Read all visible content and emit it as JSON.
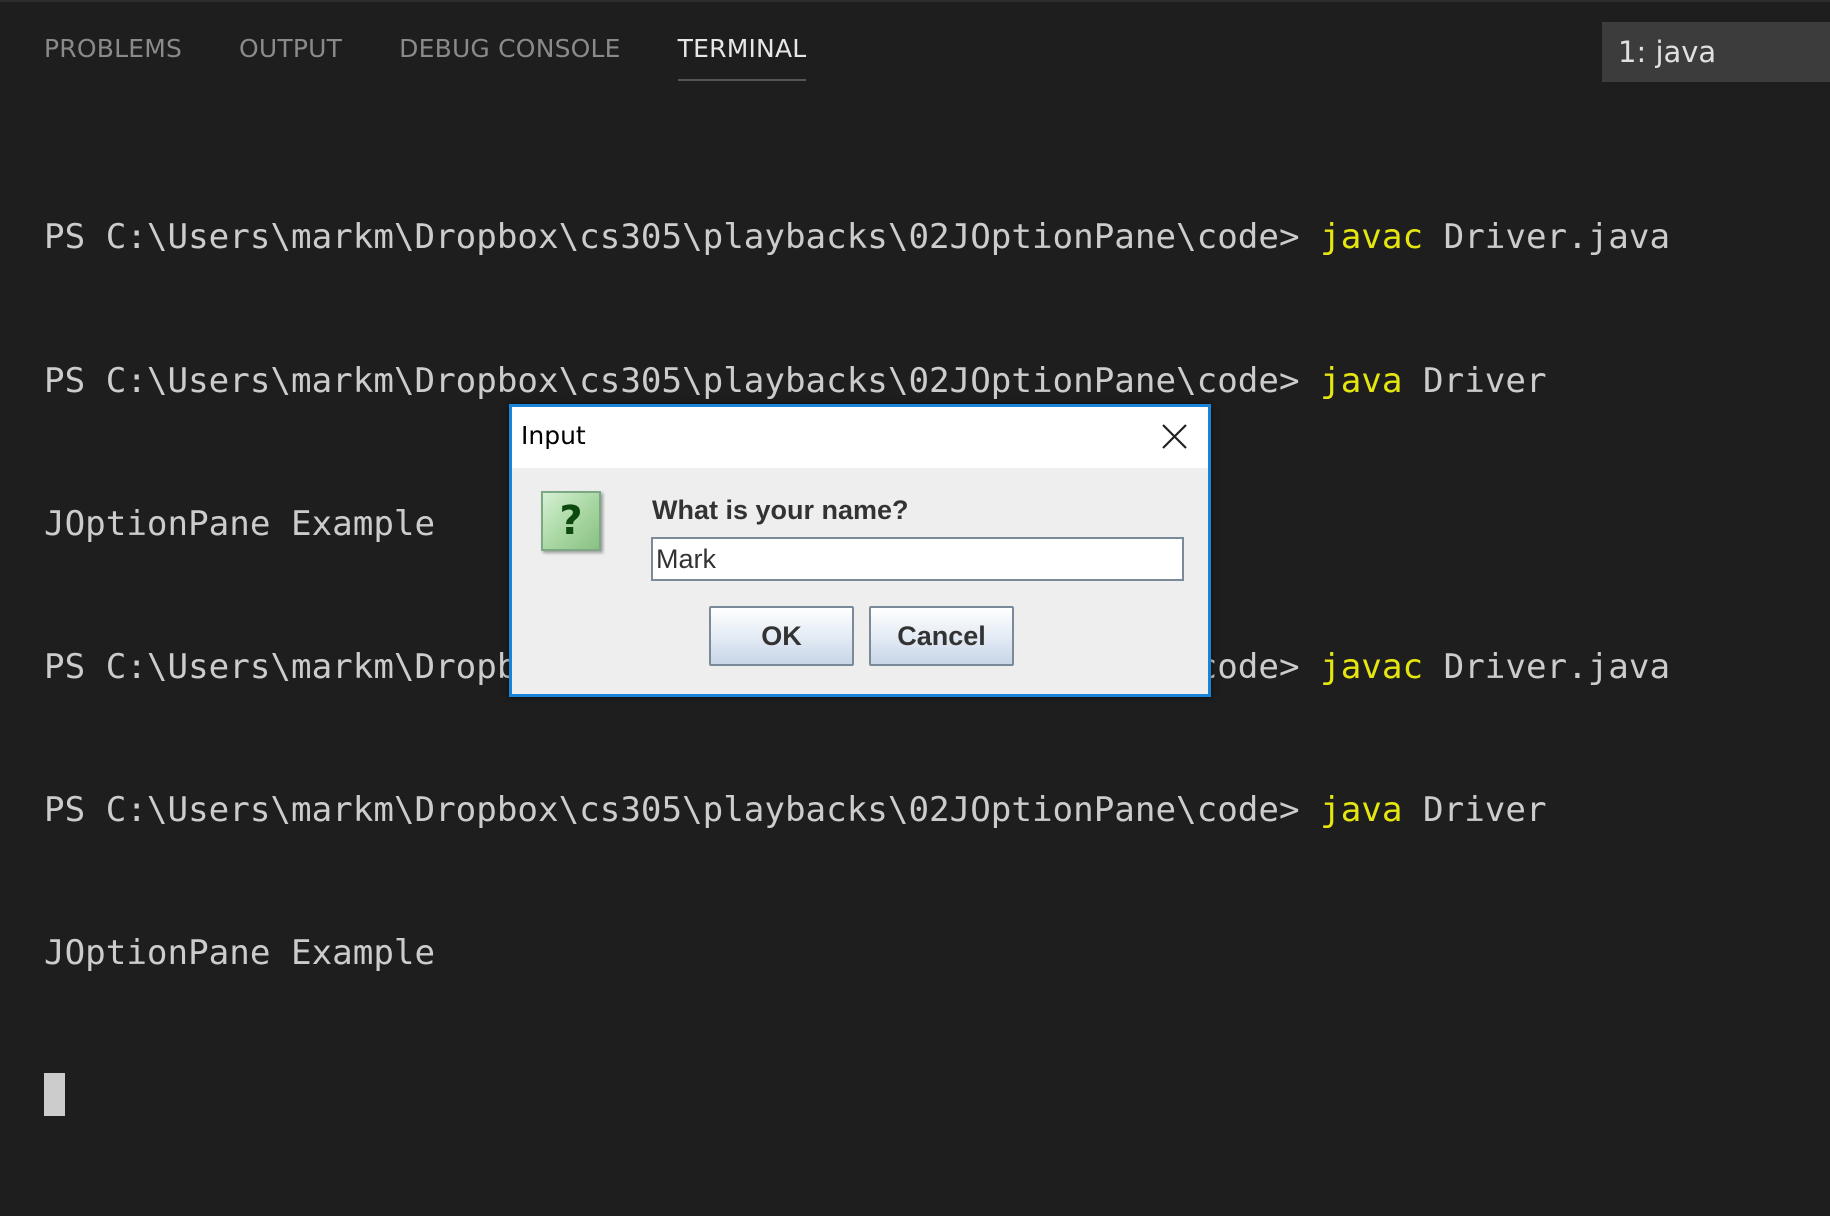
{
  "panel": {
    "tabs": [
      {
        "label": "PROBLEMS"
      },
      {
        "label": "OUTPUT"
      },
      {
        "label": "DEBUG CONSOLE"
      },
      {
        "label": "TERMINAL"
      }
    ],
    "active_tab": "TERMINAL",
    "terminal_select": "1: java"
  },
  "terminal": {
    "lines": [
      {
        "prompt": "PS C:\\Users\\markm\\Dropbox\\cs305\\playbacks\\02JOptionPane\\code> ",
        "cmd": "javac",
        "args": " Driver.java"
      },
      {
        "prompt": "PS C:\\Users\\markm\\Dropbox\\cs305\\playbacks\\02JOptionPane\\code> ",
        "cmd": "java",
        "args": " Driver"
      },
      {
        "output": "JOptionPane Example"
      },
      {
        "prompt": "PS C:\\Users\\markm\\Dropbox\\cs305\\playbacks\\02JOptionPane\\code> ",
        "cmd": "javac",
        "args": " Driver.java"
      },
      {
        "prompt": "PS C:\\Users\\markm\\Dropbox\\cs305\\playbacks\\02JOptionPane\\code> ",
        "cmd": "java",
        "args": " Driver"
      },
      {
        "output": "JOptionPane Example"
      }
    ],
    "colors": {
      "command": "#e5e510",
      "text": "#cccccc",
      "background": "#1e1e1e"
    }
  },
  "dialog": {
    "title": "Input",
    "close_icon": "close-icon",
    "icon": "question-icon",
    "icon_glyph": "?",
    "prompt": "What is your name?",
    "input_value": "Mark",
    "ok_label": "OK",
    "cancel_label": "Cancel",
    "border_color": "#1883d7"
  }
}
